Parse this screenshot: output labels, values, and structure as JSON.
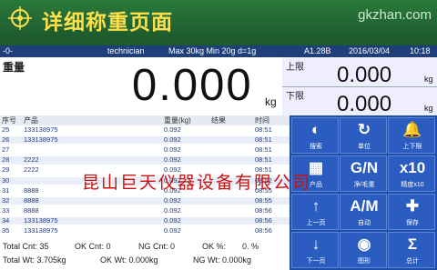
{
  "banner": {
    "title": "详细称重页面",
    "site": "gkzhan.com"
  },
  "status": {
    "left": "-0-",
    "user": "technician",
    "spec": "Max 30kg Min 20g d=1g",
    "model": "A1.28B",
    "date": "2016/03/04",
    "time": "10:18"
  },
  "weight": {
    "label": "重量",
    "value": "0.000",
    "unit": "kg"
  },
  "limits": {
    "upper": {
      "label": "上限",
      "value": "0.000",
      "unit": "kg"
    },
    "lower": {
      "label": "下限",
      "value": "0.000",
      "unit": "kg"
    }
  },
  "table": {
    "headers": [
      "序号",
      "产品",
      "重量(kg)",
      "结果",
      "时间"
    ],
    "rows": [
      [
        "25",
        "133138975",
        "0.092",
        "",
        "08:51"
      ],
      [
        "26",
        "133138975",
        "0.092",
        "",
        "08:51"
      ],
      [
        "27",
        "",
        "0.092",
        "",
        "08:51"
      ],
      [
        "28",
        "2222",
        "0.092",
        "",
        "08:51"
      ],
      [
        "29",
        "2222",
        "0.092",
        "",
        "08:51"
      ],
      [
        "30",
        "",
        "0.092",
        "",
        "08:52"
      ],
      [
        "31",
        "8888",
        "0.092",
        "",
        "08:55"
      ],
      [
        "32",
        "8888",
        "0.092",
        "",
        "08:55"
      ],
      [
        "33",
        "8888",
        "0.092",
        "",
        "08:56"
      ],
      [
        "34",
        "133138975",
        "0.092",
        "",
        "08:56"
      ],
      [
        "35",
        "133138975",
        "0.092",
        "",
        "08:56"
      ]
    ]
  },
  "totals": {
    "total_cnt": "Total Cnt: 35",
    "ok_cnt": "OK Cnt: 0",
    "ng_cnt": "NG Cnt: 0",
    "ok_pct": "OK %:",
    "ok_pct_val": "0. %",
    "total_wt": "Total Wt: 3.705kg",
    "ok_wt": "OK Wt: 0.000kg",
    "ng_wt": "NG Wt: 0.000kg"
  },
  "buttons": [
    {
      "icon": "◐",
      "label": "搜索"
    },
    {
      "icon": "↻",
      "label": "单位"
    },
    {
      "icon": "🔔",
      "label": "上下限"
    },
    {
      "icon": "▦",
      "label": "产品"
    },
    {
      "icon": "G/N",
      "label": "净/毛重"
    },
    {
      "icon": "x10",
      "label": "精度x10"
    },
    {
      "icon": "↑",
      "label": "上一页"
    },
    {
      "icon": "A/M",
      "label": "自动"
    },
    {
      "icon": "✚",
      "label": "保存"
    },
    {
      "icon": "↓",
      "label": "下一页"
    },
    {
      "icon": "◉",
      "label": "图形"
    },
    {
      "icon": "Σ",
      "label": "总计"
    }
  ],
  "watermark": "昆山巨天仪器设备有限公司"
}
